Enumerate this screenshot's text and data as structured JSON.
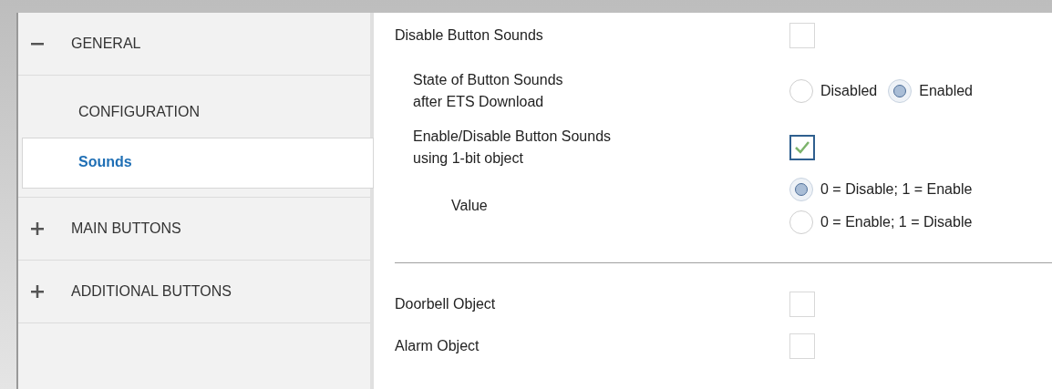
{
  "sidebar": {
    "groups": [
      {
        "label": "GENERAL",
        "expanded": true,
        "children": [
          {
            "label": "CONFIGURATION",
            "selected": false
          },
          {
            "label": "Sounds",
            "selected": true
          }
        ]
      },
      {
        "label": "MAIN BUTTONS",
        "expanded": false
      },
      {
        "label": "ADDITIONAL BUTTONS",
        "expanded": false
      }
    ]
  },
  "settings": [
    {
      "kind": "checkbox",
      "label": "Disable Button Sounds",
      "checked": false,
      "children": [
        {
          "kind": "radio_inline",
          "label": "State of Button Sounds\nafter ETS Download",
          "options": [
            {
              "label": "Disabled",
              "selected": false
            },
            {
              "label": "Enabled",
              "selected": true
            }
          ]
        },
        {
          "kind": "checkbox",
          "label": "Enable/Disable Button Sounds\nusing 1-bit object",
          "checked": true,
          "children": [
            {
              "kind": "radio_stacked",
              "label": "Value",
              "options": [
                {
                  "label": "0 = Disable; 1 = Enable",
                  "selected": true
                },
                {
                  "label": "0 = Enable; 1 = Disable",
                  "selected": false
                }
              ]
            }
          ]
        }
      ]
    },
    {
      "kind": "divider"
    },
    {
      "kind": "checkbox",
      "label": "Doorbell Object",
      "checked": false
    },
    {
      "kind": "checkbox",
      "label": "Alarm Object",
      "checked": false
    }
  ]
}
